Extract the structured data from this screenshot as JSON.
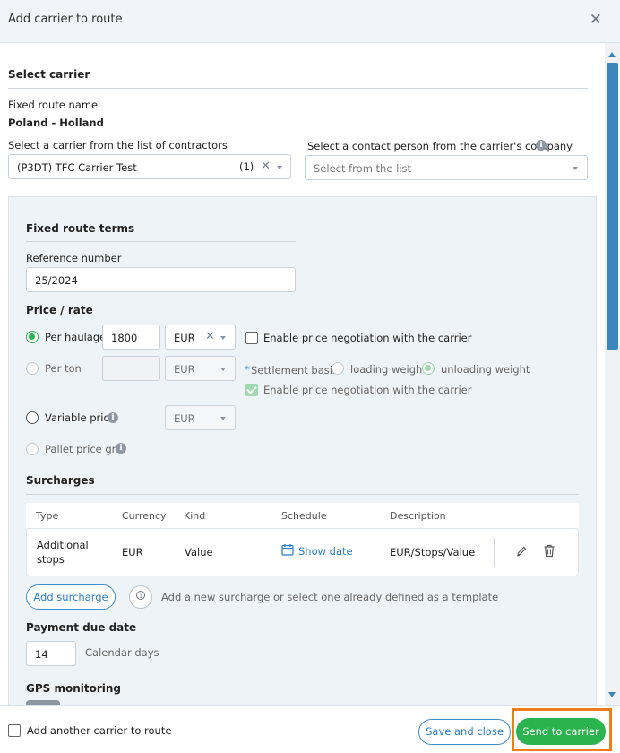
{
  "header": {
    "title": "Add carrier to route",
    "close_icon": "close-icon"
  },
  "select_carrier": {
    "heading": "Select carrier",
    "route_name_label": "Fixed route name",
    "route_name_value": "Poland - Holland",
    "carrier_label": "Select a carrier from the list of contractors",
    "carrier_value": "(P3DT) TFC Carrier Test",
    "carrier_count": "(1)",
    "contact_label": "Select a contact person from the carrier's company",
    "contact_placeholder": "Select from the list"
  },
  "terms": {
    "heading": "Fixed route terms",
    "reference_label": "Reference number",
    "reference_value": "25/2024",
    "price_heading": "Price / rate",
    "per_haulage_label": "Per haulage",
    "per_haulage_value": "1800",
    "per_haulage_currency": "EUR",
    "negotiation_label": "Enable price negotiation with the carrier",
    "per_ton_label": "Per ton",
    "per_ton_value": "",
    "per_ton_currency": "EUR",
    "settlement_label": "Settlement basis:",
    "settlement_asterisk": "*",
    "loading_weight_label": "loading weight",
    "unloading_weight_label": "unloading weight",
    "negotiation_label_2": "Enable price negotiation with the carrier",
    "variable_price_label": "Variable price",
    "variable_currency": "EUR",
    "pallet_grid_label": "Pallet price grid",
    "info_glyph": "i"
  },
  "surcharges": {
    "heading": "Surcharges",
    "columns": [
      "Type",
      "Currency",
      "Kind",
      "Schedule",
      "Description"
    ],
    "rows": [
      {
        "type_line1": "Additional",
        "type_line2": "stops",
        "currency": "EUR",
        "kind": "Value",
        "schedule": "Show date",
        "description": "EUR/Stops/Value"
      }
    ],
    "add_button": "Add surcharge",
    "hint": "Add a new surcharge or select one already defined as a template"
  },
  "payment": {
    "heading": "Payment due date",
    "days_value": "14",
    "days_unit": "Calendar days"
  },
  "gps": {
    "heading": "GPS monitoring"
  },
  "footer": {
    "add_another_label": "Add another carrier to route",
    "save_close": "Save and close",
    "send": "Send to carrier"
  },
  "colors": {
    "accent_green": "#2bb34f",
    "accent_blue": "#2a7cc7",
    "highlight": "#ef7d1a"
  }
}
